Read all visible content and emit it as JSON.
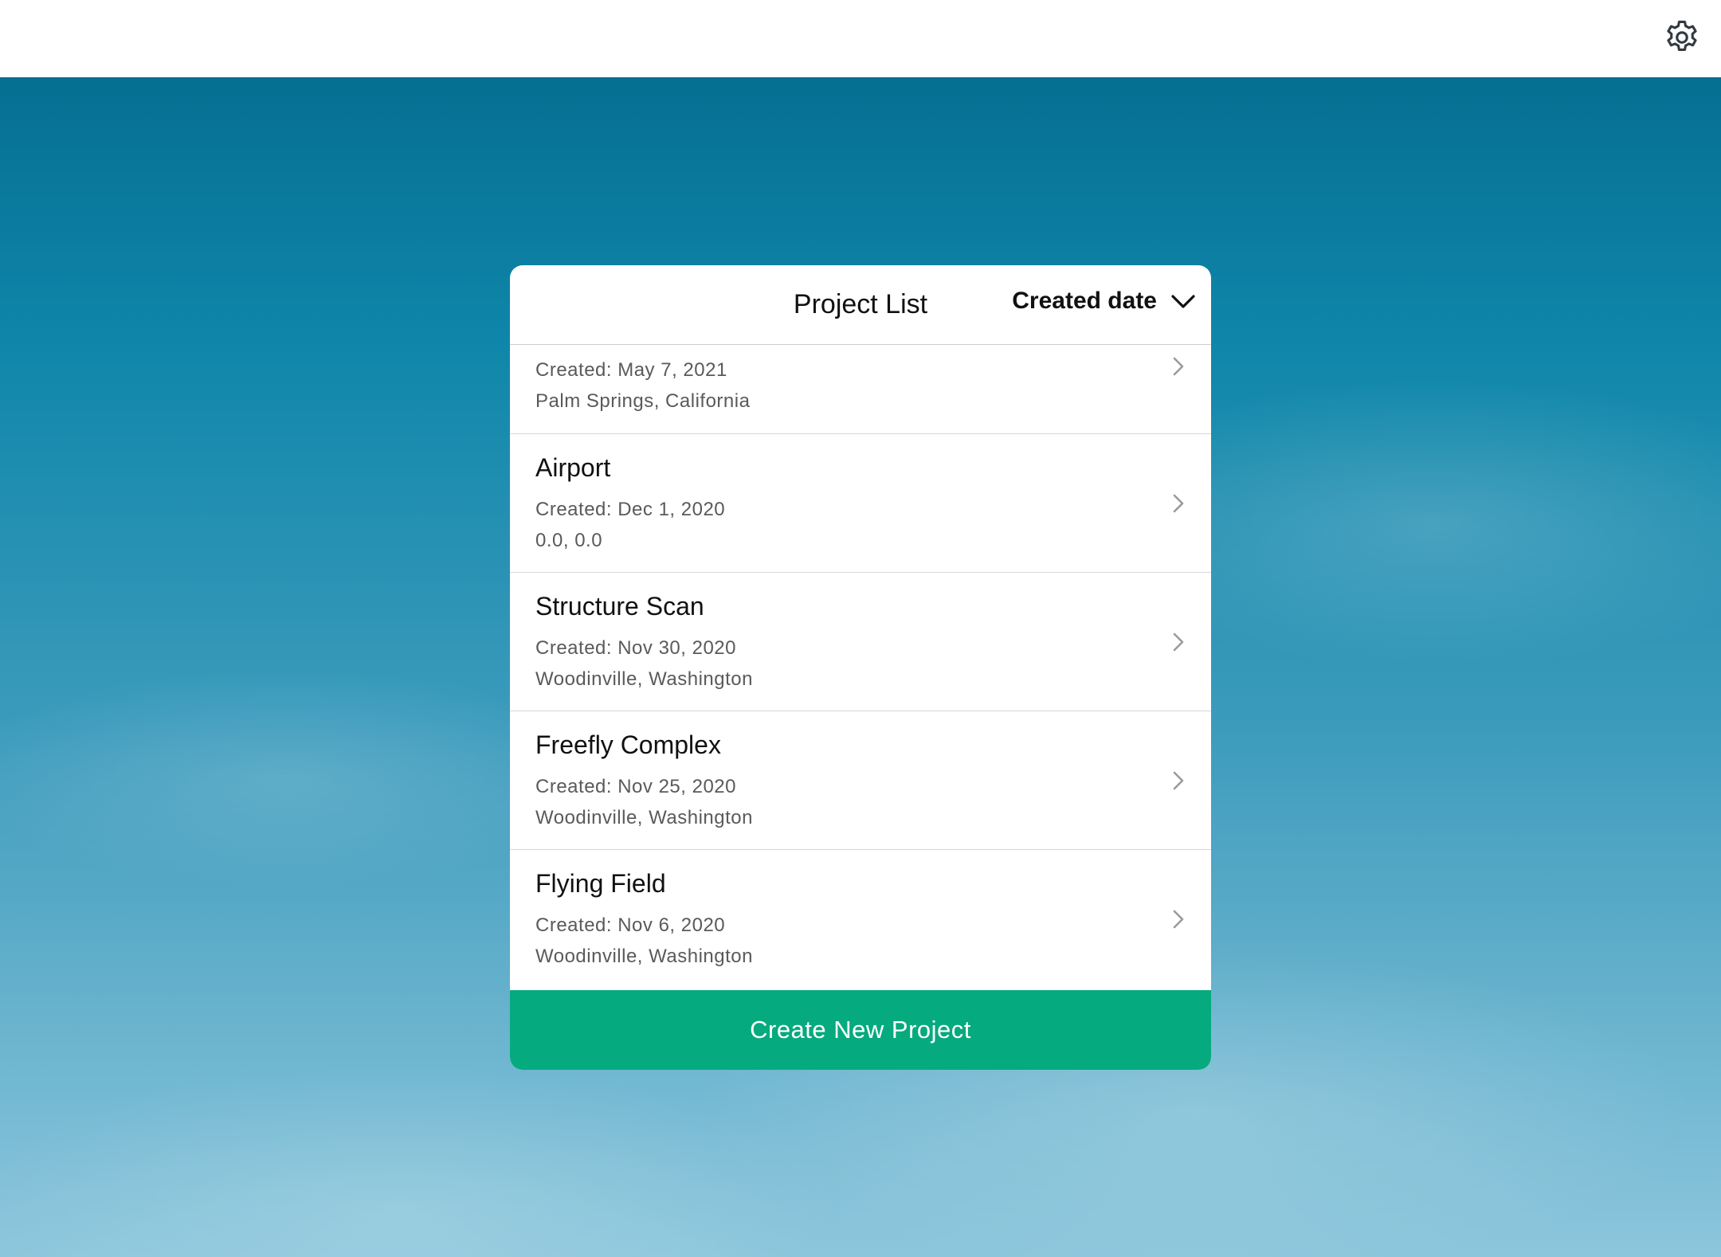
{
  "topbar": {
    "settings_icon": "gear-icon"
  },
  "panel": {
    "title": "Project List",
    "sort": {
      "label": "Created date",
      "icon": "chevron-down-icon"
    },
    "projects": [
      {
        "name": "",
        "created": "Created: May 7, 2021",
        "location": "Palm Springs, California"
      },
      {
        "name": "Airport",
        "created": "Created: Dec 1, 2020",
        "location": "0.0, 0.0"
      },
      {
        "name": "Structure Scan",
        "created": "Created: Nov 30, 2020",
        "location": "Woodinville, Washington"
      },
      {
        "name": "Freefly Complex",
        "created": "Created: Nov 25, 2020",
        "location": "Woodinville, Washington"
      },
      {
        "name": "Flying Field",
        "created": "Created: Nov 6, 2020",
        "location": "Woodinville, Washington"
      }
    ],
    "create_button_label": "Create New Project"
  },
  "colors": {
    "accent": "#06aa7f",
    "sky_top": "#066f92",
    "sky_bottom": "#8cc6dc"
  }
}
